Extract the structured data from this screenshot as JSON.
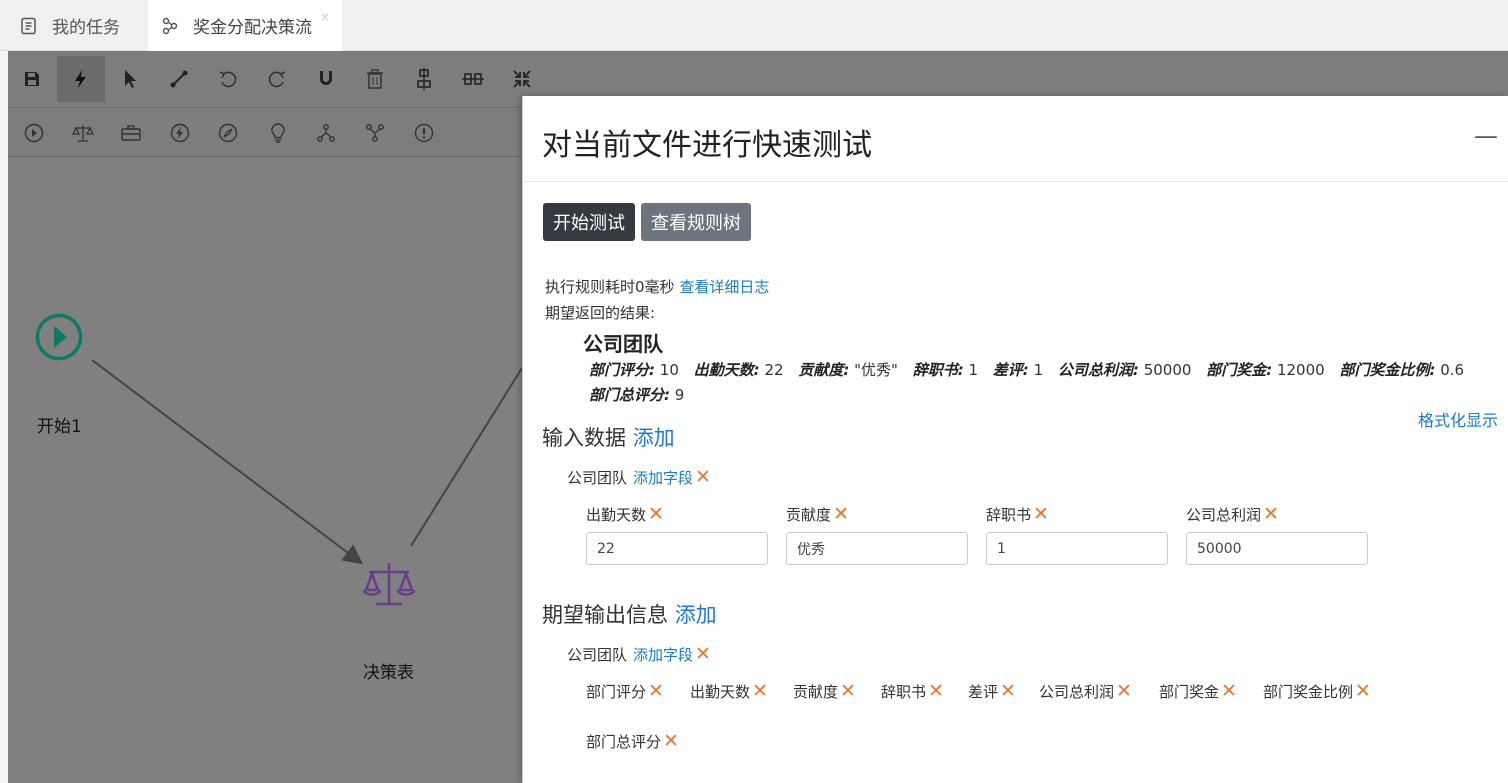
{
  "tabs": [
    {
      "label": "我的任务",
      "icon": "task-list-icon"
    },
    {
      "label": "奖金分配决策流",
      "icon": "flow-icon",
      "close": "×"
    }
  ],
  "toolbar1": [
    "save-icon",
    "lightning-icon",
    "pointer-icon",
    "connect-icon",
    "undo-icon",
    "redo-icon",
    "magnet-icon",
    "trash-icon",
    "align-vertical-icon",
    "align-horizontal-icon",
    "compress-icon"
  ],
  "toolbar2": [
    "start-node-icon",
    "decision-table-icon",
    "briefcase-icon",
    "action-icon",
    "compass-icon",
    "bulb-icon",
    "fork-icon",
    "join-icon",
    "alert-icon"
  ],
  "nodes": {
    "start_label": "开始1",
    "decision_label": "决策表"
  },
  "panel": {
    "title": "对当前文件进行快速测试",
    "minimize": "—",
    "start_button": "开始测试",
    "tree_button": "查看规则树",
    "exec_text": "执行规则耗时0毫秒",
    "exec_link": "查看详细日志",
    "expect_text": "期望返回的结果:",
    "result_entity": "公司团队",
    "result_fields": [
      {
        "key": "部门评分:",
        "value": "10"
      },
      {
        "key": "出勤天数:",
        "value": "22"
      },
      {
        "key": "贡献度:",
        "value": "\"优秀\""
      },
      {
        "key": "辞职书:",
        "value": "1"
      },
      {
        "key": "差评:",
        "value": "1"
      },
      {
        "key": "公司总利润:",
        "value": "50000"
      },
      {
        "key": "部门奖金:",
        "value": "12000"
      },
      {
        "key": "部门奖金比例:",
        "value": "0.6"
      },
      {
        "key": "部门总评分:",
        "value": "9"
      }
    ],
    "format_link": "格式化显示",
    "input_title": "输入数据",
    "add_link": "添加",
    "input_entity": "公司团队",
    "add_field_link": "添加字段",
    "remove_mark": "✕",
    "input_fields": [
      {
        "label": "出勤天数",
        "value": "22"
      },
      {
        "label": "贡献度",
        "value": "优秀"
      },
      {
        "label": "辞职书",
        "value": "1"
      },
      {
        "label": "公司总利润",
        "value": "50000"
      }
    ],
    "output_title": "期望输出信息",
    "output_entity": "公司团队",
    "output_fields": [
      "部门评分",
      "出勤天数",
      "贡献度",
      "辞职书",
      "差评",
      "公司总利润",
      "部门奖金",
      "部门奖金比例",
      "部门总评分"
    ]
  },
  "colors": {
    "accent": "#1a7ad4",
    "remove": "#f0742e",
    "start_node": "#0e7a6a",
    "decision_node": "#6a3d8a"
  }
}
